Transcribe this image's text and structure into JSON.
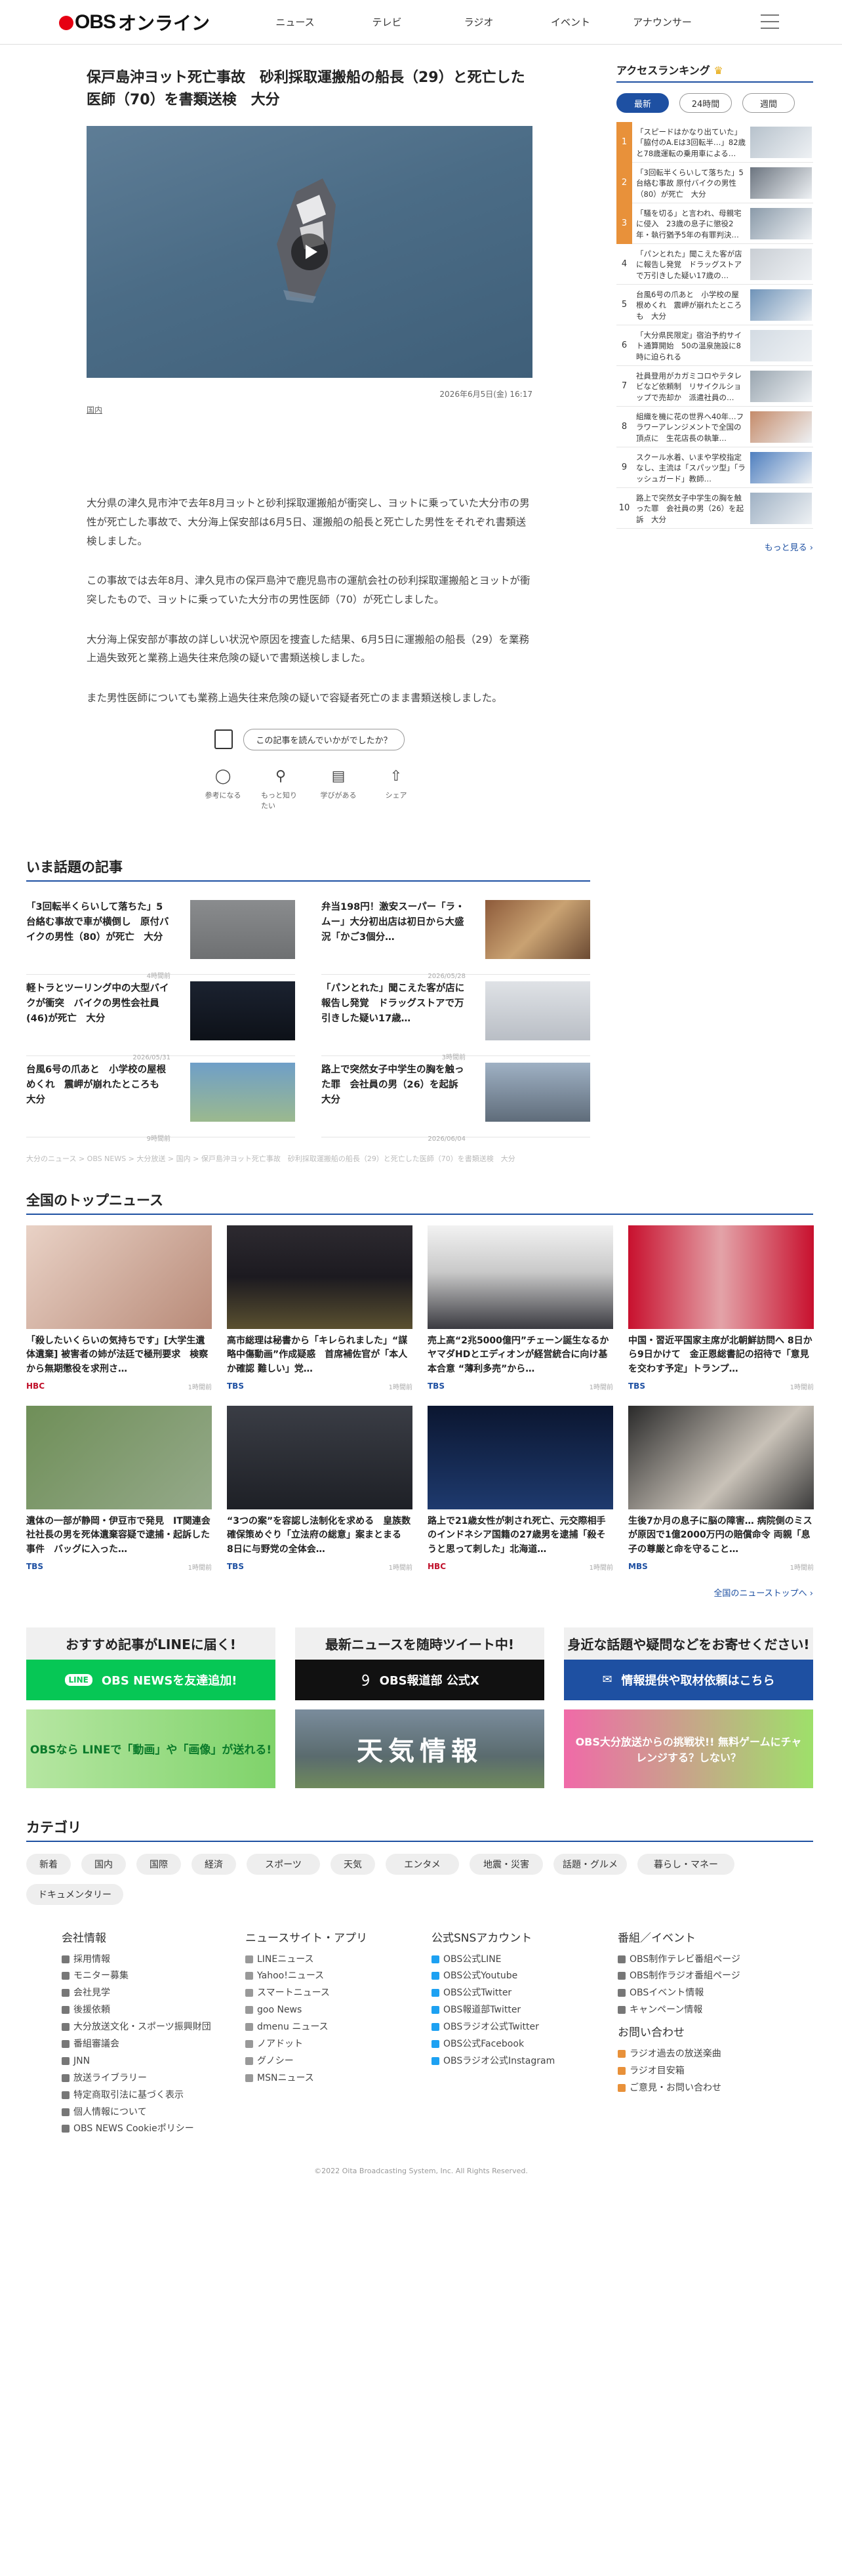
{
  "header": {
    "logo_obs": "OBS",
    "logo_online": "オンライン",
    "nav": [
      "ニュース",
      "テレビ",
      "ラジオ",
      "イベント",
      "アナウンサー"
    ]
  },
  "article": {
    "title": "保戸島沖ヨット死亡事故　砂利採取運搬船の船長（29）と死亡した医師（70）を書類送検　大分",
    "date": "2026年6月5日(金) 16:17",
    "category": "国内",
    "paragraphs": [
      "大分県の津久見市沖で去年8月ヨットと砂利採取運搬船が衝突し、ヨットに乗っていた大分市の男性が死亡した事故で、大分海上保安部は6月5日、運搬船の船長と死亡した男性をそれぞれ書類送検しました。",
      "この事故では去年8月、津久見市の保戸島沖で鹿児島市の運航会社の砂利採取運搬船とヨットが衝突したもので、ヨットに乗っていた大分市の男性医師（70）が死亡しました。",
      "大分海上保安部が事故の詳しい状況や原因を捜査した結果、6月5日に運搬船の船長（29）を業務上過失致死と業務上過失往来危険の疑いで書類送検しました。",
      "また男性医師についても業務上過失往来危険の疑いで容疑者死亡のまま書類送検しました。"
    ],
    "feedback_label": "この記事を読んでいかがでしたか？",
    "reactions": [
      "参考になる",
      "もっと知りたい",
      "学びがある",
      "シェア"
    ]
  },
  "trending": {
    "heading": "いま話題の記事",
    "items": [
      {
        "title": "「3回転半くらいして落ちた」5台絡む事故で車が横倒し　原付バイクの男性（80）が死亡　大分",
        "date": "4時間前"
      },
      {
        "title": "弁当198円！激安スーパー「ラ・ムー」大分初出店は初日から大盛況「かご3個分…",
        "date": "2026/05/28"
      },
      {
        "title": "軽トラとツーリング中の大型バイクが衝突　バイクの男性会社員(46)が死亡　大分",
        "date": "2026/05/31"
      },
      {
        "title": "「パンとれた」聞こえた客が店に報告し発覚　ドラッグストアで万引きした疑い17歳…",
        "date": "3時間前"
      },
      {
        "title": "台風6号の爪あと　小学校の屋根めくれ　震岬が崩れたところも　大分",
        "date": "9時間前"
      },
      {
        "title": "路上で突然女子中学生の胸を触った罪　会社員の男（26）を起訴　大分",
        "date": "2026/06/04"
      }
    ]
  },
  "breadcrumb": "大分のニュース > OBS NEWS > 大分放送 > 国内 > 保戸島沖ヨット死亡事故　砂利採取運搬船の船長（29）と死亡した医師（70）を書類送検　大分",
  "top_news": {
    "heading": "全国のトップニュース",
    "items": [
      {
        "title": "「殺したいくらいの気持ちです」[大学生遺体遺棄] 被害者の姉が法廷で極刑要求　検察から無期懲役を求刑さ…",
        "source": "HBC",
        "time": "1時間前",
        "color": "#c0102a"
      },
      {
        "title": "高市総理は秘書から「キレられました」“謀略中傷動画”作成疑惑　首席補佐官が「本人か確認 難しい」党…",
        "source": "TBS",
        "time": "1時間前",
        "color": "#1e50a2"
      },
      {
        "title": "売上高“2兆5000億円”チェーン誕生なるか　ヤマダHDとエディオンが経営統合に向け基本合意 “薄利多売”から…",
        "source": "TBS",
        "time": "1時間前",
        "color": "#1e50a2"
      },
      {
        "title": "中国・習近平国家主席が北朝鮮訪問へ 8日から9日かけて　金正恩総書記の招待で「意見を交わす予定」トランプ…",
        "source": "TBS",
        "time": "1時間前",
        "color": "#1e50a2"
      },
      {
        "title": "遺体の一部が静岡・伊豆市で発見　IT関連会社社長の男を死体遺棄容疑で逮捕・起訴した事件　バッグに入った…",
        "source": "TBS",
        "time": "1時間前",
        "color": "#1e50a2"
      },
      {
        "title": "“3つの案”を容認し法制化を求める　皇族数確保策めぐり「立法府の総意」案まとまる　8日に与野党の全体会…",
        "source": "TBS",
        "time": "1時間前",
        "color": "#1e50a2"
      },
      {
        "title": "路上で21歳女性が刺され死亡、元交際相手のインドネシア国籍の27歳男を逮捕「殺そうと思って刺した」北海道…",
        "source": "HBC",
        "time": "1時間前",
        "color": "#c0102a"
      },
      {
        "title": "生後7か月の息子に脳の障害… 病院側のミスが原因で1億2000万円の賠償命令 両親「息子の尊厳と命を守ること…",
        "source": "MBS",
        "time": "1時間前",
        "color": "#1e50a2"
      }
    ],
    "more": "全国のニューストップへ ›"
  },
  "promos": [
    {
      "heading": "おすすめ記事がLINEに届く!",
      "button": "OBS NEWSを友達追加!",
      "banner": "OBSなら LINEで「動画」や「画像」が送れる!",
      "color": "#06c755"
    },
    {
      "heading": "最新ニュースを随時ツイート中!",
      "button": "OBS報道部 公式X",
      "banner": "天気情報",
      "color": "#111111"
    },
    {
      "heading": "身近な話題や疑問などをお寄せください!",
      "button": "情報提供や取材依頼はこちら",
      "banner": "OBS大分放送からの挑戦状!! 無料ゲームにチャレンジする？しない？",
      "color": "#1e50a2"
    }
  ],
  "categories": {
    "heading": "カテゴリ",
    "items": [
      "新着",
      "国内",
      "国際",
      "経済",
      "スポーツ",
      "天気",
      "エンタメ",
      "地震・災害",
      "話題・グルメ",
      "暮らし・マネー",
      "ドキュメンタリー"
    ]
  },
  "footer": {
    "cols": [
      {
        "heading": "会社情報",
        "items": [
          "採用情報",
          "モニター募集",
          "会社見学",
          "後援依頼",
          "大分放送文化・スポーツ振興財団",
          "番組審議会",
          "JNN",
          "放送ライブラリー",
          "特定商取引法に基づく表示",
          "個人情報について",
          "OBS NEWS Cookieポリシー"
        ]
      },
      {
        "heading": "ニュースサイト・アプリ",
        "items": [
          "LINEニュース",
          "Yahoo!ニュース",
          "スマートニュース",
          "goo News",
          "dmenu ニュース",
          "ノアドット",
          "グノシー",
          "MSNニュース"
        ]
      },
      {
        "heading": "公式SNSアカウント",
        "items": [
          "OBS公式LINE",
          "OBS公式Youtube",
          "OBS公式Twitter",
          "OBS報道部Twitter",
          "OBSラジオ公式Twitter",
          "OBS公式Facebook",
          "OBSラジオ公式Instagram"
        ]
      },
      {
        "heading": "番組／イベント",
        "items": [
          "OBS制作テレビ番組ページ",
          "OBS制作ラジオ番組ページ",
          "OBSイベント情報",
          "キャンペーン情報"
        ],
        "heading2": "お問い合わせ",
        "items2": [
          "ラジオ過去の放送楽曲",
          "ラジオ目安箱",
          "ご意見・お問い合わせ"
        ]
      }
    ],
    "copyright": "©2022 Oita Broadcasting System, Inc. All Rights Reserved."
  },
  "ranking": {
    "heading": "アクセスランキング",
    "tabs": [
      "最新",
      "24時間",
      "週間"
    ],
    "items": [
      "「スピードはかなり出ていた」「脇付のA.Eは3回転半…」82歳と78歳運転の乗用車による…",
      "「3回転半くらいして落ちた」5台絡む事故 原付バイクの男性（80）が死亡　大分",
      "「騒を切る」と言われ、母親宅に侵入　23歳の息子に懲役2年・執行猶予5年の有罪判決…",
      "「パンとれた」聞こえた客が店に報告し発覚　ドラッグストアで万引きした疑い17歳の…",
      "台風6号の爪あと　小学校の屋根めくれ　震岬が崩れたところも　大分",
      "「大分県民限定」宿泊予約サイト通算開始　50の温泉施設に8時に迫られる",
      "社員登用がカガミコロやテタレビなど依頼制　リサイクルショップで売却か　派遣社員の…",
      "組織を機に花の世界へ40年…フラワーアレンジメントで全国の頂点に　生花店長の執筆…",
      "スクール水着、いまや学校指定なし、主流は「スパッツ型」「ラッシュガード」教師…",
      "路上で突然女子中学生の胸を触った罪　会社員の男（26）を起訴　大分"
    ],
    "more": "もっと見る ›"
  }
}
